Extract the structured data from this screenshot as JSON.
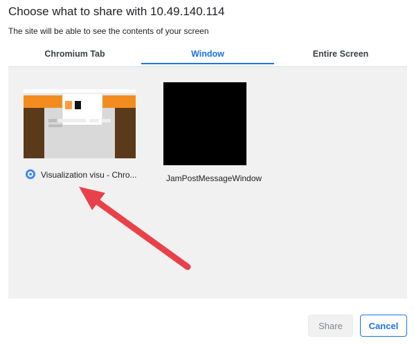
{
  "dialog": {
    "title": "Choose what to share with 10.49.140.114",
    "subtitle": "The site will be able to see the contents of your screen"
  },
  "tabs": [
    {
      "label": "Chromium Tab",
      "active": false
    },
    {
      "label": "Window",
      "active": true
    },
    {
      "label": "Entire Screen",
      "active": false
    }
  ],
  "sources": [
    {
      "label": "Visualization visu - Chro...",
      "icon": "chromium-icon"
    },
    {
      "label": "JamPostMessageWindow",
      "icon": ""
    }
  ],
  "buttons": {
    "share_label": "Share",
    "cancel_label": "Cancel"
  },
  "colors": {
    "accent": "#1a73e8",
    "annotation_arrow": "#e8414a",
    "thumb_orange": "#f28c1f",
    "thumb_brown": "#5b3a1a"
  }
}
